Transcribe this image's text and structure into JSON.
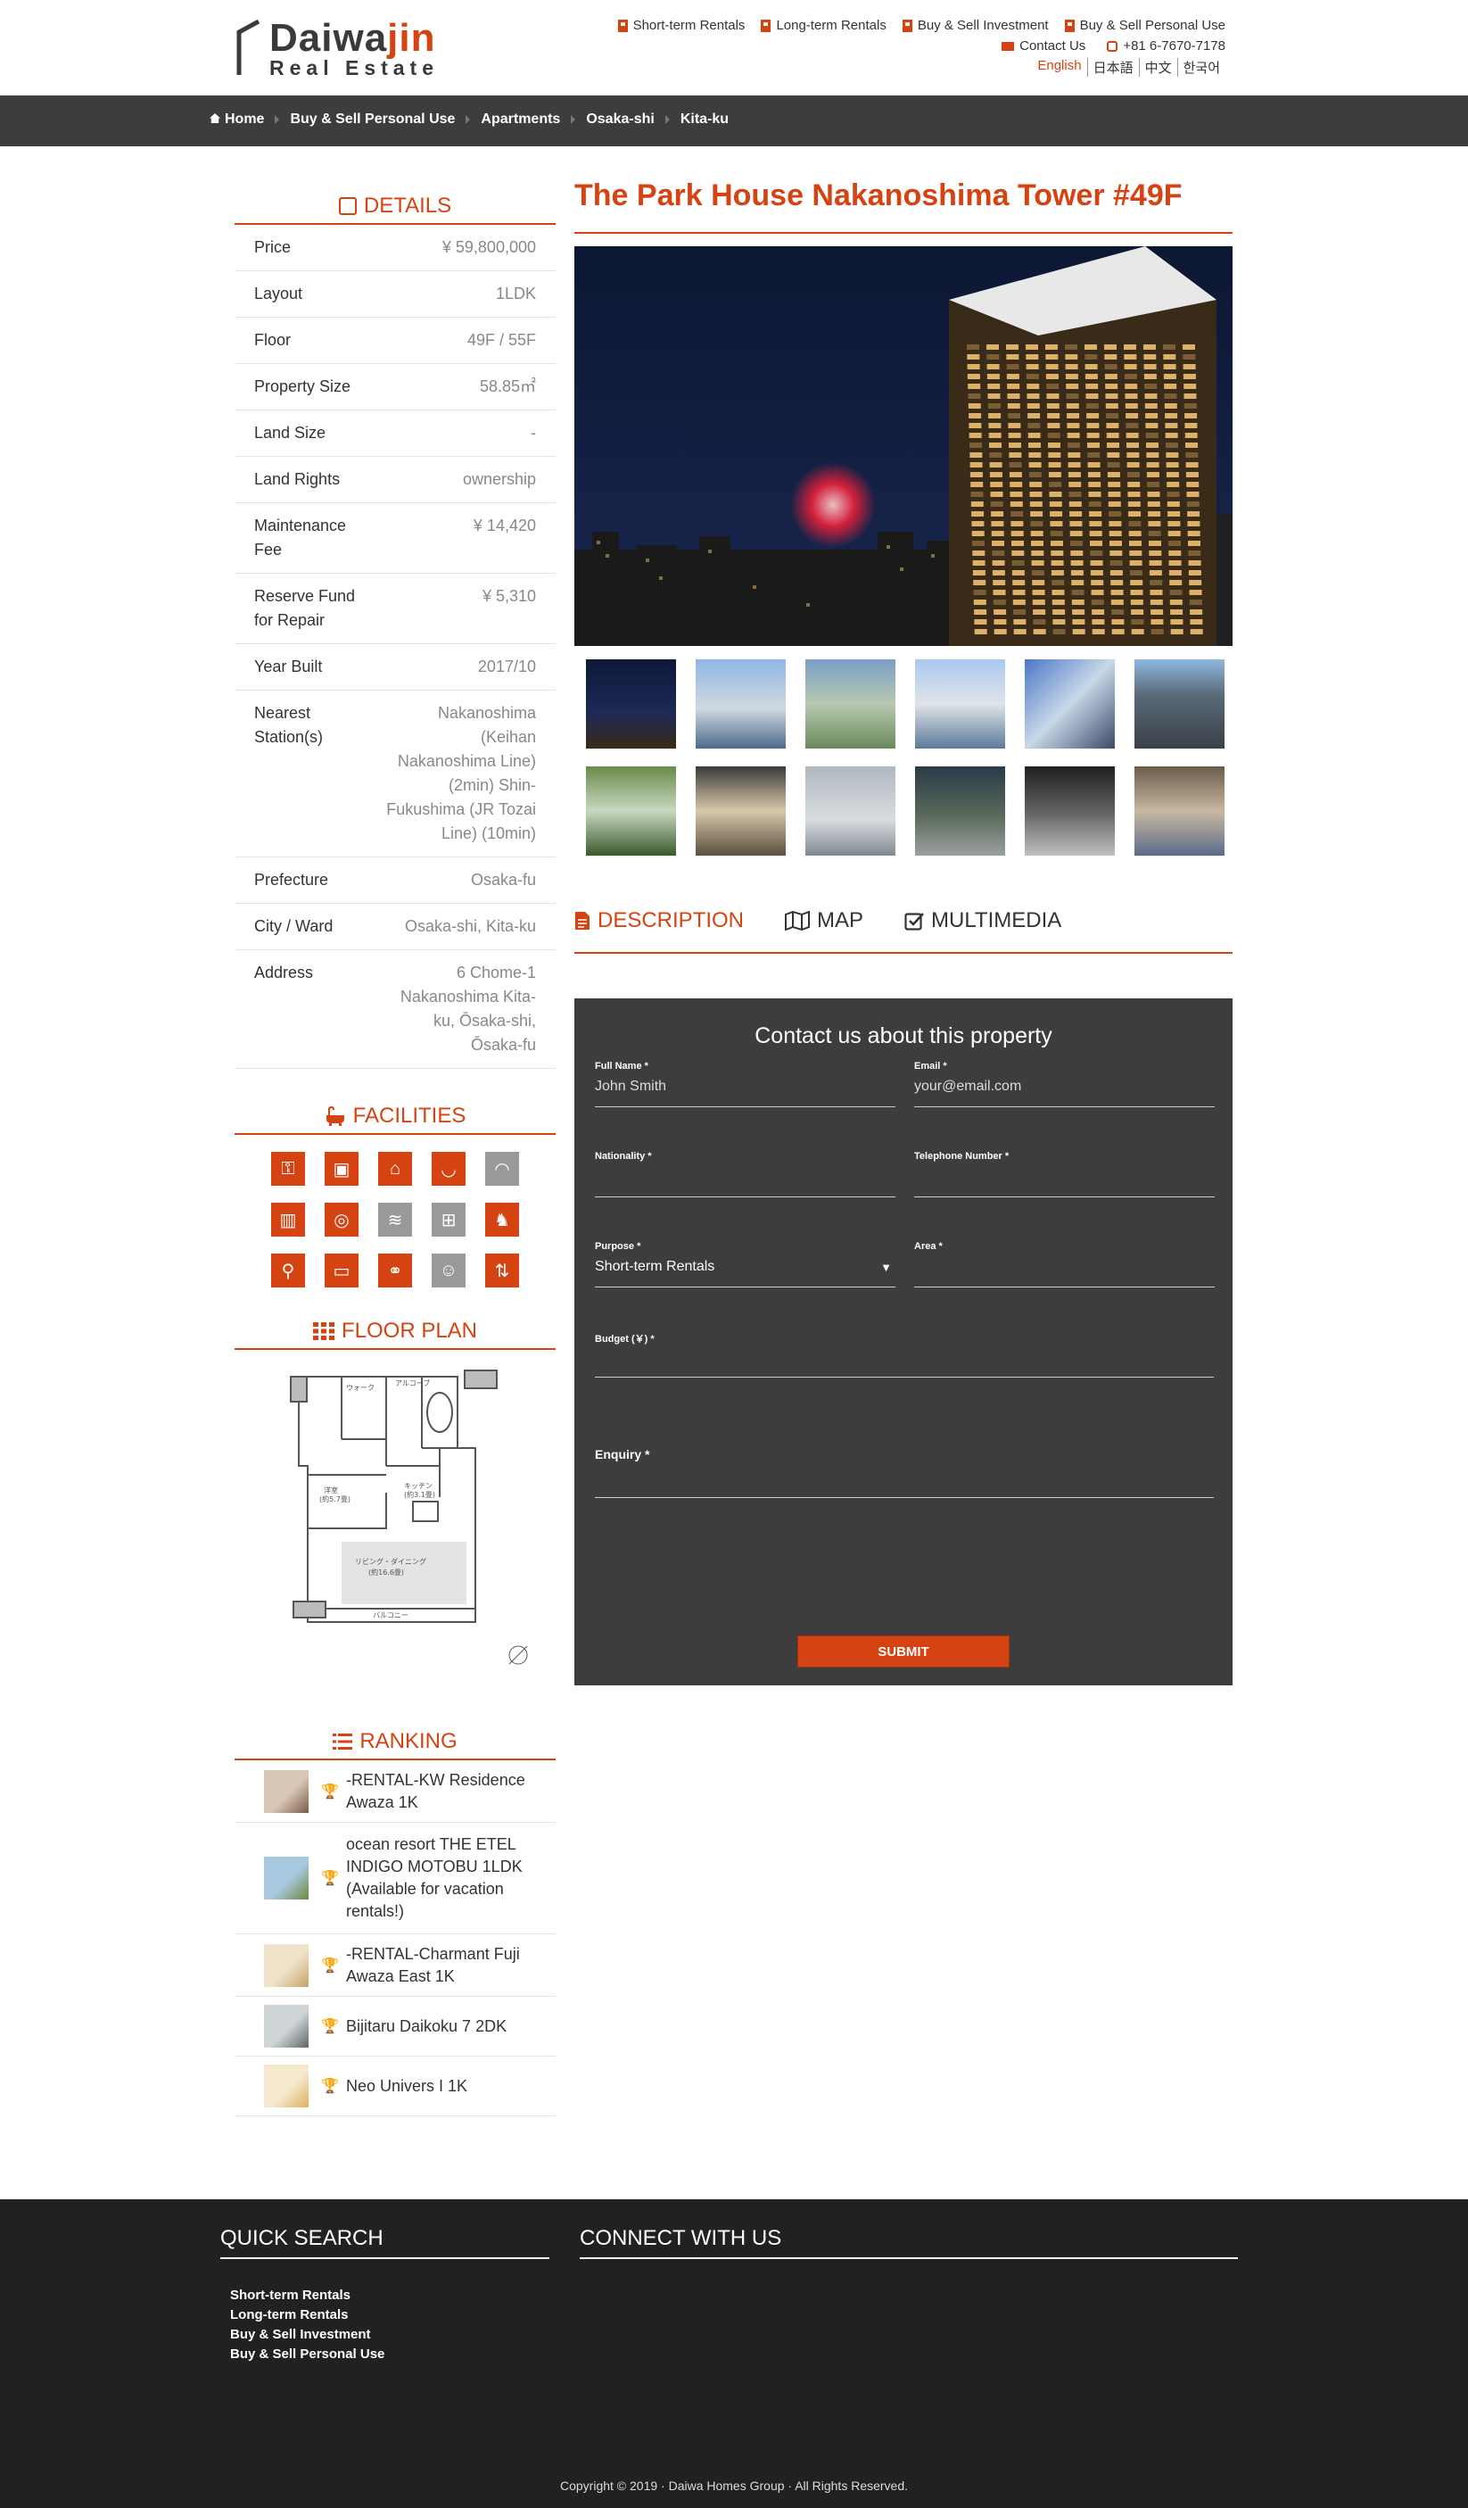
{
  "header": {
    "logo_main": "Daiwa",
    "logo_accent": "jin",
    "logo_sub": "Real Estate",
    "nav": [
      "Short-term Rentals",
      "Long-term Rentals",
      "Buy & Sell Investment",
      "Buy & Sell Personal Use"
    ],
    "contact_label": "Contact Us",
    "phone": "+81 6-7670-7178",
    "languages": [
      "English",
      "日本語",
      "中文",
      "한국어"
    ]
  },
  "breadcrumb": [
    "Home",
    "Buy & Sell Personal Use",
    "Apartments",
    "Osaka-shi",
    "Kita-ku"
  ],
  "details": {
    "heading": "DETAILS",
    "rows": [
      {
        "k": "Price",
        "v": "¥ 59,800,000"
      },
      {
        "k": "Layout",
        "v": "1LDK"
      },
      {
        "k": "Floor",
        "v": "49F / 55F"
      },
      {
        "k": "Property Size",
        "v": "58.85㎡"
      },
      {
        "k": "Land Size",
        "v": "-"
      },
      {
        "k": "Land Rights",
        "v": "ownership"
      },
      {
        "k": "Maintenance Fee",
        "v": "¥ 14,420"
      },
      {
        "k": "Reserve Fund for Repair",
        "v": "¥ 5,310"
      },
      {
        "k": "Year Built",
        "v": "2017/10"
      },
      {
        "k": "Nearest Station(s)",
        "v": "Nakanoshima (Keihan Nakanoshima Line) (2min) Shin-Fukushima (JR Tozai Line) (10min)"
      },
      {
        "k": "Prefecture",
        "v": "Osaka-fu"
      },
      {
        "k": "City / Ward",
        "v": "Osaka-shi, Kita-ku"
      },
      {
        "k": "Address",
        "v": "6 Chome-1 Nakanoshima Kita-ku, Ōsaka-shi, Ōsaka-fu"
      }
    ]
  },
  "facilities": {
    "heading": "FACILITIES",
    "items": [
      {
        "icon": "key-icon",
        "glyph": "⚿",
        "active": true
      },
      {
        "icon": "intercom-icon",
        "glyph": "▣",
        "active": true
      },
      {
        "icon": "kitchen-sink-icon",
        "glyph": "⌂",
        "active": true
      },
      {
        "icon": "bath-icon",
        "glyph": "◡",
        "active": true
      },
      {
        "icon": "wifi-icon",
        "glyph": "◠",
        "active": false
      },
      {
        "icon": "closet-icon",
        "glyph": "▥",
        "active": true
      },
      {
        "icon": "washing-machine-icon",
        "glyph": "◎",
        "active": true
      },
      {
        "icon": "air-conditioner-icon",
        "glyph": "≋",
        "active": false
      },
      {
        "icon": "stove-icon",
        "glyph": "⊞",
        "active": false
      },
      {
        "icon": "pet-icon",
        "glyph": "♞",
        "active": true
      },
      {
        "icon": "bicycle-parking-icon",
        "glyph": "⚲",
        "active": true
      },
      {
        "icon": "car-parking-icon",
        "glyph": "▭",
        "active": true
      },
      {
        "icon": "motorcycle-parking-icon",
        "glyph": "⚭",
        "active": true
      },
      {
        "icon": "concierge-icon",
        "glyph": "☺",
        "active": false
      },
      {
        "icon": "elevator-icon",
        "glyph": "⇅",
        "active": true
      }
    ]
  },
  "floorplan": {
    "heading": "FLOOR PLAN"
  },
  "ranking": {
    "heading": "RANKING",
    "items": [
      {
        "title": "-RENTAL-KW Residence Awaza 1K",
        "trophy": "#e6b800"
      },
      {
        "title": "ocean resort THE ETEL INDIGO MOTOBU 1LDK (Available for vacation rentals!)",
        "trophy": "#a0a0a0"
      },
      {
        "title": "-RENTAL-Charmant Fuji Awaza East 1K",
        "trophy": "#8b5a2b"
      },
      {
        "title": "Bijitaru Daikoku 7 2DK",
        "trophy": "#222222"
      },
      {
        "title": "Neo Univers I 1K",
        "trophy": "#222222"
      }
    ]
  },
  "property": {
    "title": "The Park House Nakanoshima Tower #49F",
    "tabs": [
      {
        "label": "DESCRIPTION",
        "icon": "document-icon",
        "active": true
      },
      {
        "label": "MAP",
        "icon": "map-icon",
        "active": false
      },
      {
        "label": "MULTIMEDIA",
        "icon": "check-square-icon",
        "active": false
      }
    ]
  },
  "contact_form": {
    "heading": "Contact us about this property",
    "full_name_label": "Full Name *",
    "full_name_placeholder": "John Smith",
    "email_label": "Email *",
    "email_placeholder": "your@email.com",
    "nationality_label": "Nationality *",
    "telephone_label": "Telephone Number *",
    "purpose_label": "Purpose *",
    "purpose_value": "Short-term Rentals",
    "area_label": "Area *",
    "budget_label": "Budget (￥) *",
    "enquiry_label": "Enquiry *",
    "submit_label": "SUBMIT"
  },
  "footer": {
    "quick_search_heading": "QUICK SEARCH",
    "quick_links": [
      "Short-term Rentals",
      "Long-term Rentals",
      "Buy & Sell Investment",
      "Buy & Sell Personal Use"
    ],
    "connect_heading": "CONNECT WITH US",
    "copyright": "Copyright © 2019 · Daiwa Homes Group · All Rights Reserved."
  },
  "colors": {
    "accent": "#d64312",
    "dark_bar": "#3d3d3d",
    "footer": "#212121"
  }
}
